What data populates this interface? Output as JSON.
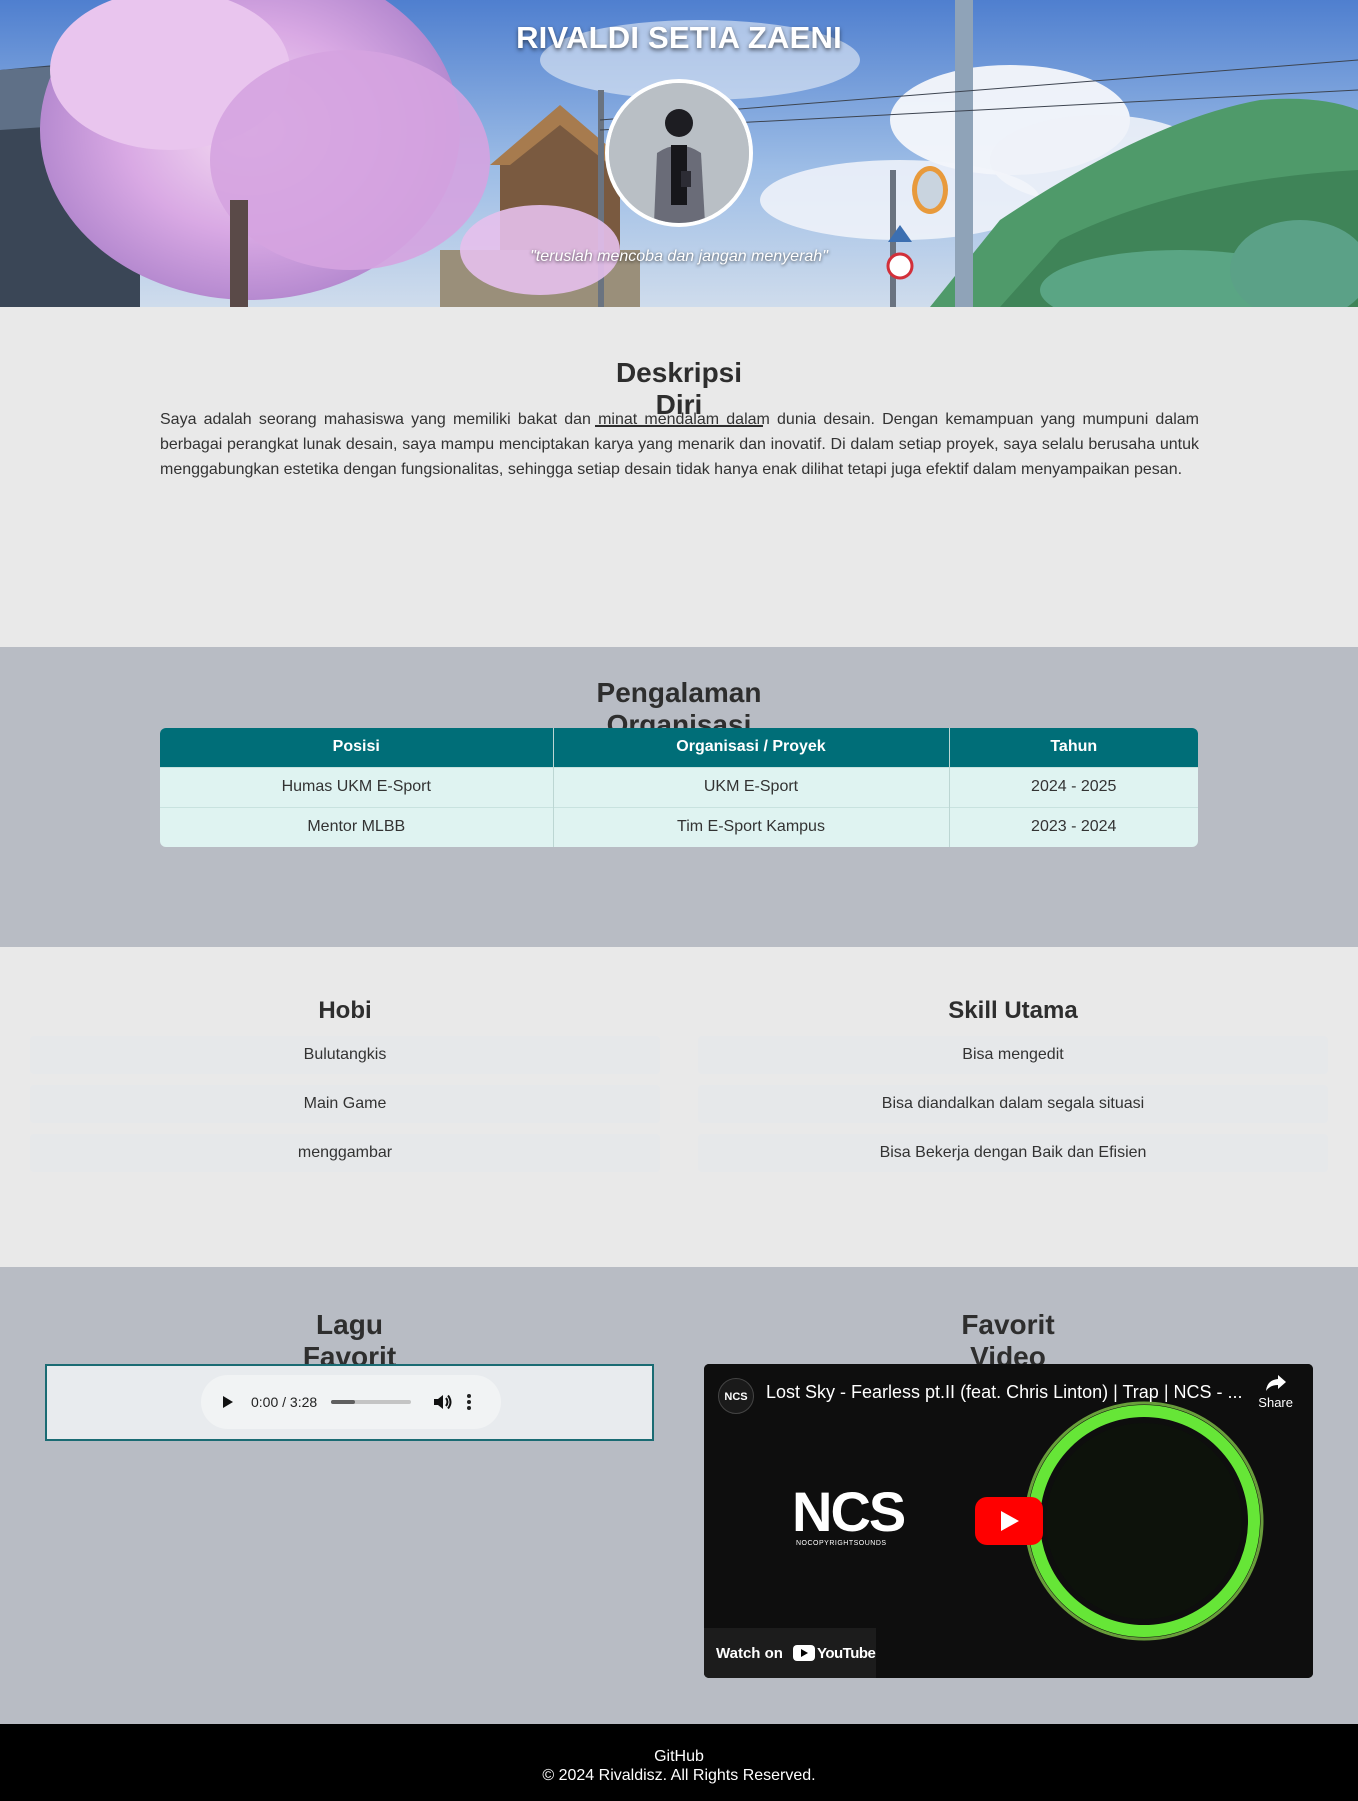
{
  "header": {
    "name": "RIVALDI SETIA ZAENI",
    "quote": "\"teruslah mencoba dan jangan menyerah\""
  },
  "about": {
    "title": "Deskripsi Diri",
    "text": "Saya adalah seorang mahasiswa yang memiliki bakat dan minat mendalam dalam dunia desain. Dengan kemampuan yang mumpuni dalam berbagai perangkat lunak desain, saya mampu menciptakan karya yang menarik dan inovatif. Di dalam setiap proyek, saya selalu berusaha untuk menggabungkan estetika dengan fungsionalitas, sehingga setiap desain tidak hanya enak dilihat tetapi juga efektif dalam menyampaikan pesan."
  },
  "organization": {
    "title": "Pengalaman Organisasi",
    "columns": [
      "Posisi",
      "Organisasi / Proyek",
      "Tahun"
    ],
    "rows": [
      [
        "Humas UKM E-Sport",
        "UKM E-Sport",
        "2024 - 2025"
      ],
      [
        "Mentor MLBB",
        "Tim E-Sport Kampus",
        "2023 - 2024"
      ]
    ]
  },
  "hobi": {
    "title": "Hobi",
    "items": [
      "Bulutangkis",
      "Main Game",
      "menggambar"
    ]
  },
  "skills": {
    "title": "Skill Utama",
    "items": [
      "Bisa mengedit",
      "Bisa diandalkan dalam segala situasi",
      "Bisa Bekerja dengan Baik dan Efisien"
    ]
  },
  "music": {
    "title": "Lagu Favorit",
    "time": "0:00 / 3:28",
    "progress": 0.3
  },
  "video": {
    "title_section": "Favorit Video",
    "video_title": "Lost Sky - Fearless pt.II (feat. Chris Linton) | Trap | NCS - ...",
    "channel_logo": "NCS",
    "share": "Share",
    "watch_on": "Watch on",
    "youtube": "YouTube",
    "thumb_logo": "NCS",
    "thumb_sub": "NOCOPYRIGHTSOUNDS"
  },
  "footer": {
    "link": "GitHub",
    "copyright": "© 2024 Rivaldisz. All Rights Reserved."
  },
  "colors": {
    "table_header": "#006e78",
    "table_cell": "#dff3f1",
    "section_gray": "#b8bcc4",
    "section_light": "#e9e9e9"
  }
}
